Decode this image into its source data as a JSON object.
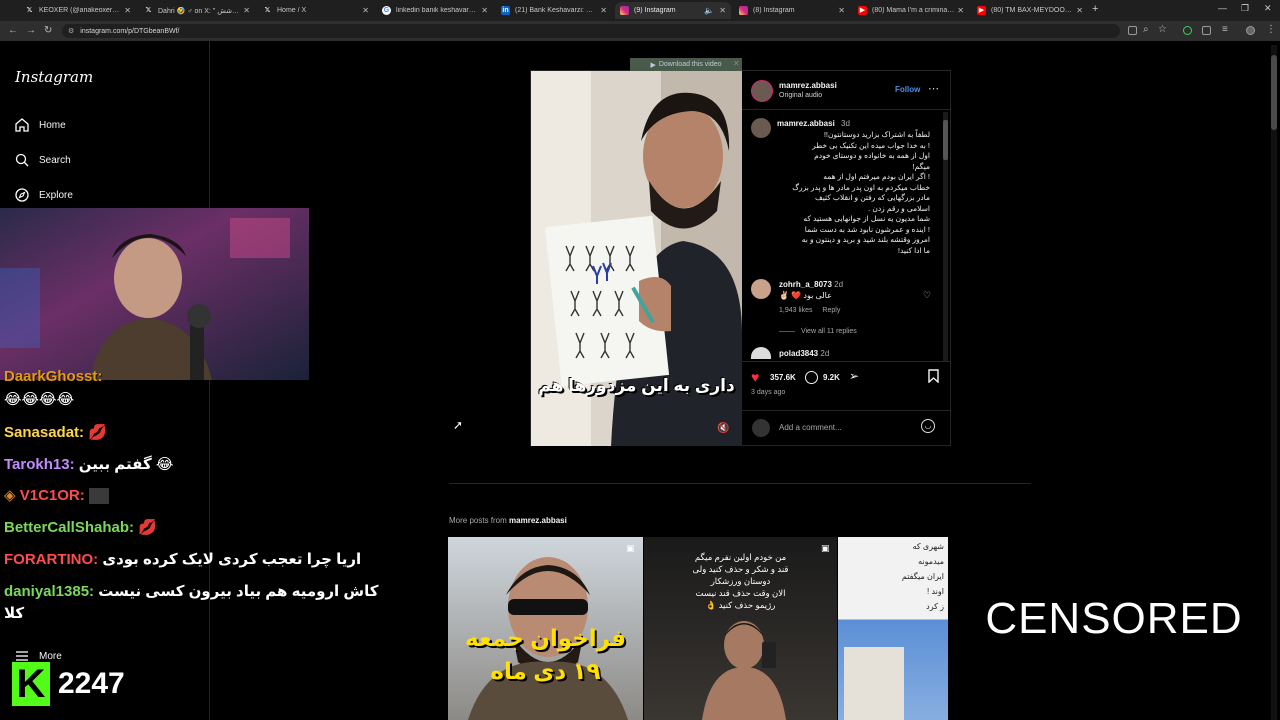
{
  "browser": {
    "tabs": [
      {
        "icon": "x-icon",
        "label": "KEOXER (@ariakeoxer) / X",
        "active": false
      },
      {
        "icon": "x-icon",
        "label": "Dahri 🤣 ♂ on X: \" برای پوشش",
        "active": false
      },
      {
        "icon": "x-icon",
        "label": "Home / X",
        "active": false
      },
      {
        "icon": "google-icon",
        "label": "linkedin banik keshavarzi - Goo",
        "active": false
      },
      {
        "icon": "linkedin-icon",
        "label": "(21) Bank Keshavarzi: Overview",
        "active": false
      },
      {
        "icon": "instagram-icon",
        "label": "(9) Instagram",
        "active": true
      },
      {
        "icon": "instagram-icon",
        "label": "(8) Instagram",
        "active": false
      },
      {
        "icon": "youtube-icon",
        "label": "(80) Mama I'm a criminal (Offic",
        "active": false
      },
      {
        "icon": "youtube-icon",
        "label": "(80) TM BAX-MEYDOON OFFIC",
        "active": false
      }
    ],
    "url": "instagram.com/p/DTGbeanBWf/"
  },
  "sidebar": {
    "logo": "Instagram",
    "items": [
      {
        "label": "Home",
        "icon": "home-icon"
      },
      {
        "label": "Search",
        "icon": "search-icon"
      },
      {
        "label": "Explore",
        "icon": "explore-icon"
      }
    ],
    "more": "More"
  },
  "stream": {
    "chat": [
      {
        "user": "DaarkGhosst:",
        "message": "😂😂😂😂",
        "color": "#ffb000"
      },
      {
        "user": "Sanasadat:",
        "message": "💋",
        "color": "#ffd54a"
      },
      {
        "user": "Tarokh13:",
        "message": "گفتم ببین 😂",
        "color": "#c08cff"
      },
      {
        "user": "V1C1OR:",
        "message": "",
        "color": "#ff4d4d"
      },
      {
        "user": "BetterCallShahab:",
        "message": "💋",
        "color": "#7bd85a"
      },
      {
        "user": "FORARTINO:",
        "message": "اریا چرا تعجب کردی لایک کرده بودی",
        "color": "#ff4d4d"
      },
      {
        "user": "daniyal1385:",
        "message": "کاش ارومیه هم بیاد بیرون کسی نیست",
        "color": "#7bd85a"
      },
      {
        "user": "",
        "message": "کلا",
        "color": "#ffffff"
      }
    ],
    "viewer_count": "2247",
    "k_logo": "K"
  },
  "post": {
    "download_bar": "Download this video",
    "video_caption": "داری به این مزدورها هم",
    "author": "mamrez.abbasi",
    "audio": "Original audio",
    "follow": "Follow",
    "caption_time": "3d",
    "caption_lines": [
      "لطفاً به اشتراک بزارید دوستانتون!!",
      "! به خدا جواب میده این تکنیک بی خطر",
      "اول از همه به خانواده و دوستای خودم",
      "میگم!",
      "! اگر ایران بودم میرفتم اول از همه",
      "خطاب میکردم به اون پدر مادر ها و پدر بزرگ",
      "مادر بزرگهایی که رفتن و انقلاب کثیف",
      "اسلامی و رقم زدن .",
      "شما مدیون  یه نسل از جوانهایی هستید که",
      "! اینده و عمرشون نابود شد به دست شما",
      "امروز وقتشه بلند شید و برید و دینتون و به",
      "ما ادا کنید!"
    ],
    "comments": [
      {
        "user": "zohrh_a_8073",
        "time": "2d",
        "text": "✌🏻 ❤️ عالی بود",
        "likes": "1,943 likes",
        "reply": "Reply",
        "view_replies": "View all 11 replies"
      },
      {
        "user": "polad3843",
        "time": "2d"
      }
    ],
    "likes": "357.6K",
    "comments_count": "9.2K",
    "posted": "3 days ago",
    "add_comment": "Add a comment..."
  },
  "more_posts": {
    "label_prefix": "More posts from",
    "label_user": "mamrez.abbasi",
    "thumb1_text": [
      "فراخوان جمعه",
      "۱۹ دی ماه"
    ],
    "thumb2_text": [
      "من خودم اولین نفرم میگم",
      "قند و شکر و حذف کنید ولی",
      "دوستان ورزشکار",
      "الان وقت حذف قند نیست",
      "رژیمو حذف کنید 👌"
    ],
    "thumb3_text": [
      "شهری که",
      "میدمونه",
      "ایران میگفتم",
      "اوند !",
      "ز کرد"
    ]
  },
  "overlay": {
    "censored": "CENSORED"
  }
}
